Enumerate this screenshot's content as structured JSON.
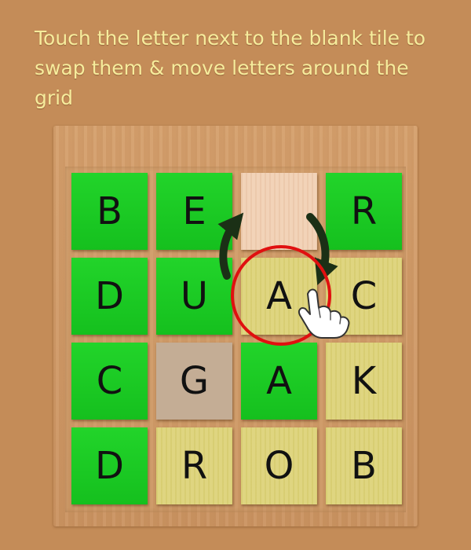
{
  "instruction": "Touch the letter next to the blank tile to swap them & move letters around the grid",
  "grid": {
    "rows": 4,
    "cols": 4,
    "tiles": [
      {
        "letter": "B",
        "state": "green"
      },
      {
        "letter": "E",
        "state": "green"
      },
      {
        "letter": "",
        "state": "blank"
      },
      {
        "letter": "R",
        "state": "green"
      },
      {
        "letter": "D",
        "state": "green"
      },
      {
        "letter": "U",
        "state": "green"
      },
      {
        "letter": "A",
        "state": "yellow"
      },
      {
        "letter": "C",
        "state": "yellow"
      },
      {
        "letter": "C",
        "state": "green"
      },
      {
        "letter": "G",
        "state": "tan"
      },
      {
        "letter": "A",
        "state": "green"
      },
      {
        "letter": "K",
        "state": "yellow"
      },
      {
        "letter": "D",
        "state": "green"
      },
      {
        "letter": "R",
        "state": "yellow"
      },
      {
        "letter": "O",
        "state": "yellow"
      },
      {
        "letter": "B",
        "state": "yellow"
      }
    ]
  },
  "colors": {
    "background": "#c48c58",
    "instruction_text": "#f6ec9c",
    "green_tile": "#1ac822",
    "yellow_tile": "#ddd379",
    "tan_tile": "#c4ad95",
    "blank_tile": "#f1d0b4",
    "highlight_circle": "#e01010",
    "swap_arrows": "#1b3016"
  },
  "icons": [
    "swap-arrows-icon",
    "hand-pointer-icon",
    "highlight-circle"
  ]
}
